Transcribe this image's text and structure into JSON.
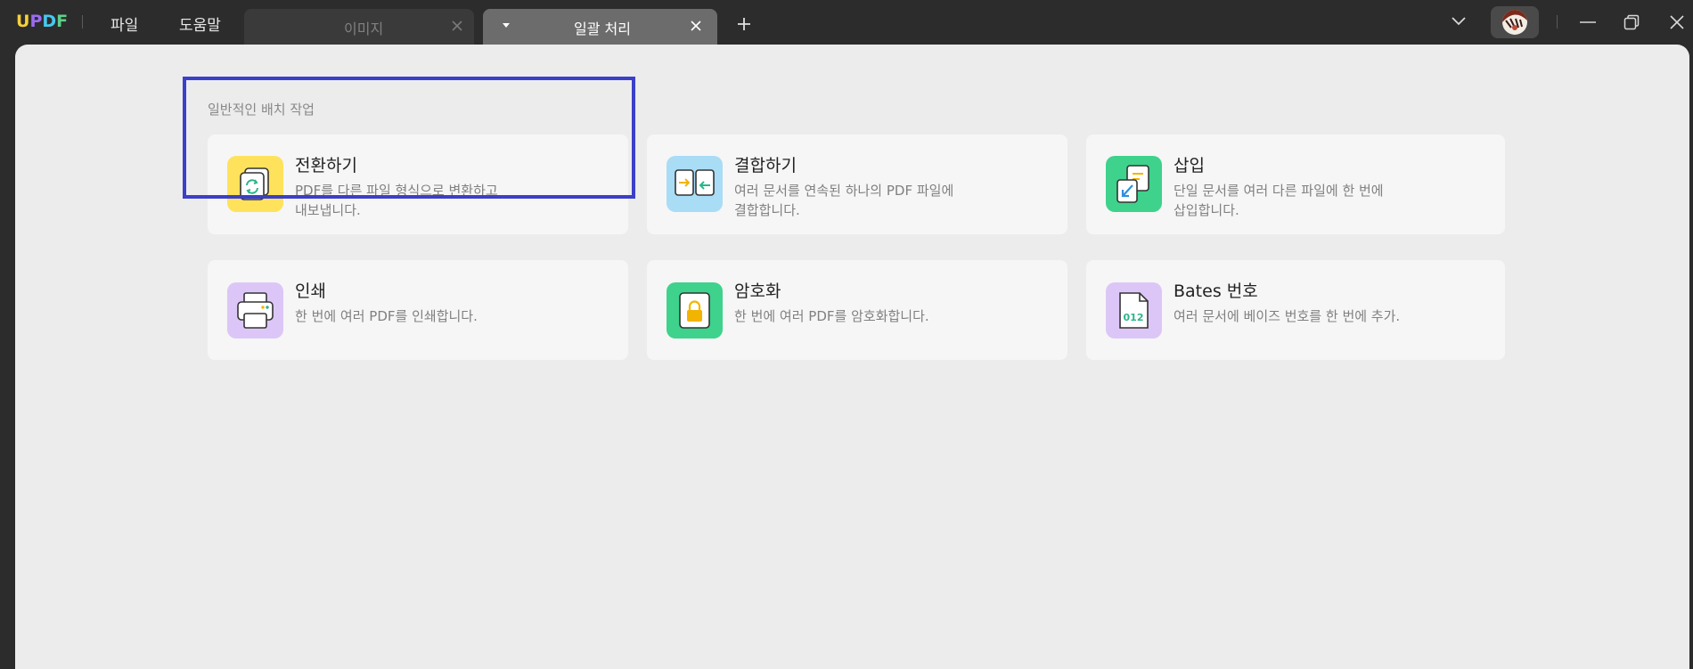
{
  "app": {
    "logo_letters": [
      "U",
      "P",
      "D",
      "F"
    ],
    "logo_colors": [
      "#f7d038",
      "#9b6cf2",
      "#48c7ee",
      "#5dd08a"
    ]
  },
  "menu": {
    "file": "파일",
    "help": "도움말"
  },
  "tabs": [
    {
      "label": "이미지",
      "active": false
    },
    {
      "label": "일괄 처리",
      "active": true
    }
  ],
  "main": {
    "section_title": "일반적인 배치 작업",
    "cards": [
      {
        "title": "전환하기",
        "desc_line1": "PDF를 다른 파일 형식으로 변환하고",
        "desc_line2": "내보냅니다.",
        "icon": "convert-icon",
        "color": "#ffe25c"
      },
      {
        "title": "결합하기",
        "desc_line1": "여러 문서를 연속된 하나의 PDF 파일에",
        "desc_line2": "결합합니다.",
        "icon": "combine-icon",
        "color": "#a9dcf5"
      },
      {
        "title": "삽입",
        "desc_line1": "단일 문서를 여러 다른 파일에 한 번에",
        "desc_line2": "삽입합니다.",
        "icon": "insert-icon",
        "color": "#3ed28c"
      },
      {
        "title": "인쇄",
        "desc_line1": "한 번에 여러 PDF를 인쇄합니다.",
        "desc_line2": "",
        "icon": "printer-icon",
        "color": "#dcc6f7"
      },
      {
        "title": "암호화",
        "desc_line1": "한 번에 여러 PDF를 암호화합니다.",
        "desc_line2": "",
        "icon": "lock-icon",
        "color": "#3ed28c"
      },
      {
        "title": "Bates 번호",
        "desc_line1": "여러 문서에 베이즈 번호를 한 번에 추가.",
        "desc_line2": "",
        "icon": "bates-number-icon",
        "color": "#dcc6f7",
        "icon_text": "012"
      }
    ]
  },
  "highlight_color": "#3b3fc9"
}
